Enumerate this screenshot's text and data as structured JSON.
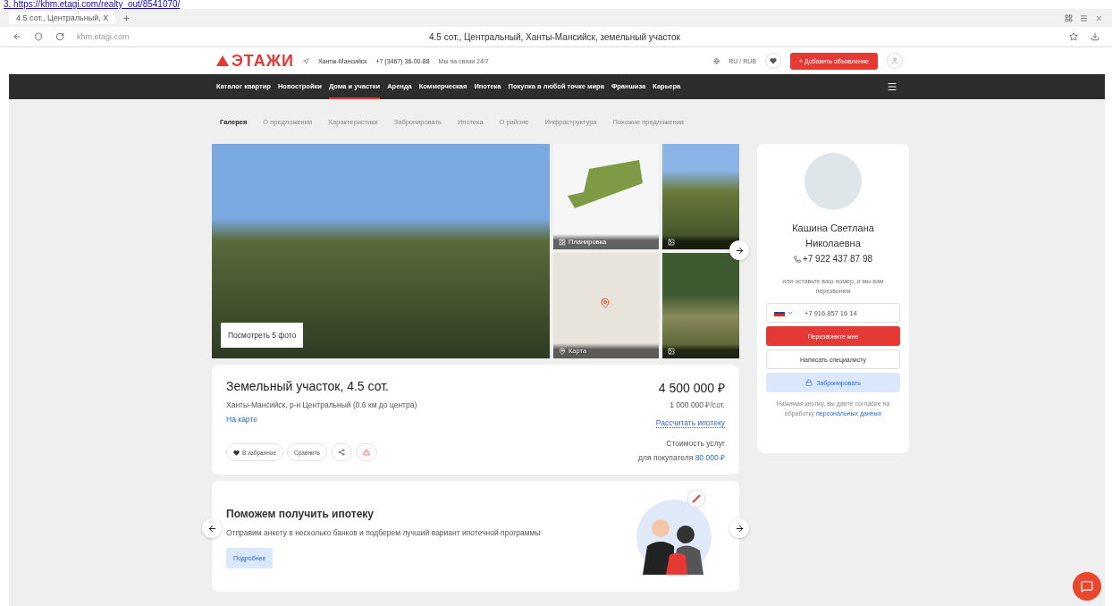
{
  "top_link": "3. https://khm.etagi.com/realty_out/8541070/",
  "browser": {
    "tabs": [
      {
        "label": "4.5 сот., Центральный, X",
        "selected": true
      }
    ],
    "address": "khm.etagi.com",
    "page_title": "4.5 сот., Центральный, Ханты-Мансийск, земельный участок"
  },
  "header": {
    "logo": "ЭТАЖИ",
    "city": "Ханты-Мансийск",
    "phone": "+7 (3467) 36-00-88",
    "support": "Мы на связи 24/7",
    "locale": "RU / RUB",
    "add_button": "+ Добавить объявление"
  },
  "nav": [
    {
      "label": "Каталог квартир",
      "selected": false
    },
    {
      "label": "Новостройки",
      "selected": false
    },
    {
      "label": "Дома и участки",
      "selected": true
    },
    {
      "label": "Аренда",
      "selected": false
    },
    {
      "label": "Коммерческая",
      "selected": false
    },
    {
      "label": "Ипотека",
      "selected": false
    },
    {
      "label": "Покупка в любой точке мира",
      "selected": false
    },
    {
      "label": "Франшиза",
      "selected": false
    },
    {
      "label": "Карьера",
      "selected": false
    }
  ],
  "anchors": [
    {
      "label": "Галерея",
      "selected": true
    },
    {
      "label": "О предложении",
      "selected": false
    },
    {
      "label": "Характеристики",
      "selected": false
    },
    {
      "label": "Забронировать",
      "selected": false
    },
    {
      "label": "Ипотека",
      "selected": false
    },
    {
      "label": "О районе",
      "selected": false
    },
    {
      "label": "Инфраструктура",
      "selected": false
    },
    {
      "label": "Похожие предложения",
      "selected": false
    }
  ],
  "gallery": {
    "view_button": "Посмотреть 5 фото",
    "plan_label": "Планировка",
    "map_label": "Карта"
  },
  "listing": {
    "title": "Земельный участок, 4.5 сот.",
    "address": "Ханты-Мансийск, р-н Центральный (0.6 км до центра)",
    "map_link": "На карте",
    "price": "4 500 000 ₽",
    "price_per": "1 000 000 ₽/сот.",
    "mortgage_link": "Рассчитать ипотеку",
    "services_label": "Стоимость услуг",
    "services_buyer": "для покупателя",
    "services_price": "80 000 ₽",
    "favorite": "В избранное",
    "compare": "Сравнить"
  },
  "promo": {
    "title": "Поможем получить ипотеку",
    "text": "Отправим анкету в несколько банков и подберем лучший вариант ипотечной программы",
    "button": "Подробнее"
  },
  "agent": {
    "name": "Кашина Светлана Николаевна",
    "phone": "+7 922 437 87 98",
    "hint": "или оставьте ваш номер, и мы вам перезвоним",
    "phone_input": "+7 916 857 16 14",
    "call_button": "Перезвоните мне",
    "write_button": "Написать специалисту",
    "book_button": "Забронировать",
    "consent": "Нажимая кнопку, вы даете согласие на обработку",
    "consent_link": "персональных данных"
  }
}
